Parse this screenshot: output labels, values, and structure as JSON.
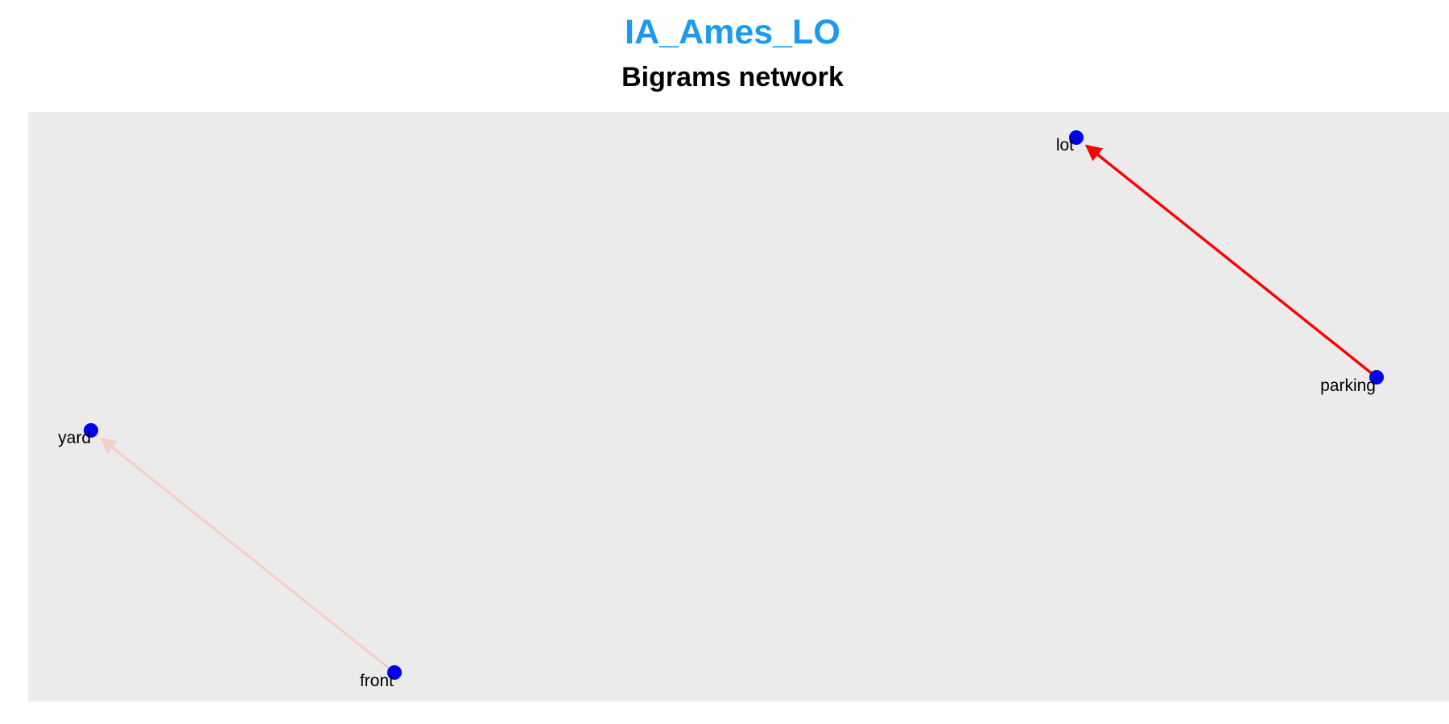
{
  "header": {
    "title": "IA_Ames_LO",
    "subtitle": "Bigrams network"
  },
  "colors": {
    "title": "#1a9bef",
    "panel_background": "#ebebeb",
    "node": "#0000ee",
    "edge_strong": "#ff0000",
    "edge_weak": "#f5d0cb"
  },
  "network": {
    "nodes": [
      {
        "id": "lot",
        "label": "lot"
      },
      {
        "id": "parking",
        "label": "parking"
      },
      {
        "id": "yard",
        "label": "yard"
      },
      {
        "id": "front",
        "label": "front"
      }
    ],
    "edges": [
      {
        "from": "parking",
        "to": "lot",
        "strength": "strong"
      },
      {
        "from": "front",
        "to": "yard",
        "strength": "weak"
      }
    ]
  }
}
